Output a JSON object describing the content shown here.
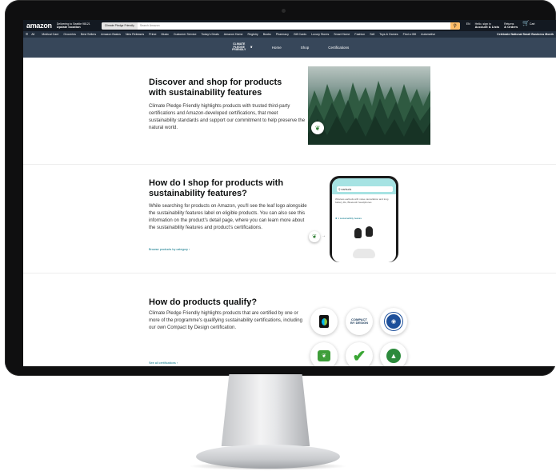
{
  "header": {
    "logo": "amazon",
    "deliver_line1": "Delivering to Seattle 98121",
    "deliver_line2": "Update location",
    "search_dept": "Climate Pledge Friendly",
    "search_placeholder": "Search Amazon",
    "language": "EN",
    "account_line1": "Hello, sign in",
    "account_line2": "Account & Lists",
    "orders_line1": "Returns",
    "orders_line2": "& Orders",
    "cart_label": "Cart"
  },
  "nav": {
    "all": "All",
    "items": [
      "Medical Care",
      "Groceries",
      "Best Sellers",
      "Amazon Basics",
      "New Releases",
      "Prime",
      "Music",
      "Customer Service",
      "Today's Deals",
      "Amazon Home",
      "Registry",
      "Books",
      "Pharmacy",
      "Gift Cards",
      "Luxury Stores",
      "Smart Home",
      "Fashion",
      "Sell",
      "Toys & Games",
      "Find a Gift",
      "Automotive"
    ],
    "promo": "Celebrate National Small Business Month"
  },
  "subnav": {
    "logo_text": "CLIMATE PLEDGE FRIENDLY",
    "links": [
      "Home",
      "Shop",
      "Certifications"
    ]
  },
  "section1": {
    "title": "Discover and shop for products with sustainability features",
    "body": "Climate Pledge Friendly highlights products with trusted third-party certifications and Amazon-developed certifications, that meet sustainability standards and support our commitment to help preserve the natural world."
  },
  "section2": {
    "title": "How do I shop for products with sustainability features?",
    "body": "While searching for products on Amazon, you'll see the leaf logo alongside the sustainability features label on eligible products. You can also see this information on the product's detail page, where you can learn more about the sustainability features and product's certifications.",
    "link": "Browse products by category ›",
    "phone_search": "earbuds",
    "phone_text": "Wireless earbuds with noise cancellation and long battery life, Bluetooth headphones",
    "phone_label": "1 sustainability feature"
  },
  "section3": {
    "title": "How do products qualify?",
    "body": "Climate Pledge Friendly highlights products that are certified by one or more of the programme's qualifying sustainability certifications, including our own Compact by Design certification.",
    "link": "See all certifications ›",
    "cert_cbd": "COMPACT BY DESIGN"
  }
}
